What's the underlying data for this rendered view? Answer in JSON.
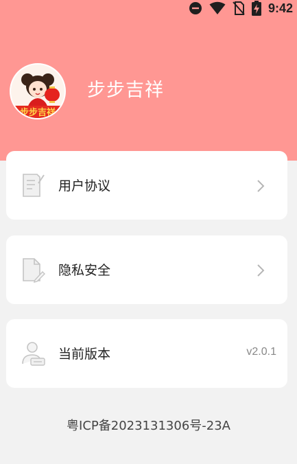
{
  "status_bar": {
    "time": "9:42",
    "icons": [
      "do-not-disturb-icon",
      "wifi-icon",
      "no-sim-icon",
      "battery-charging-icon"
    ]
  },
  "header": {
    "app_name": "步步吉祥",
    "avatar_text": "步步吉祥",
    "bg_color": "#ff9793"
  },
  "menu": {
    "user_agreement": {
      "label": "用户协议",
      "icon": "document-edit-icon"
    },
    "privacy": {
      "label": "隐私安全",
      "icon": "file-edit-icon"
    },
    "version": {
      "label": "当前版本",
      "icon": "user-badge-icon",
      "value": "v2.0.1"
    }
  },
  "footer": {
    "icp": "粤ICP备2023131306号-23A"
  }
}
